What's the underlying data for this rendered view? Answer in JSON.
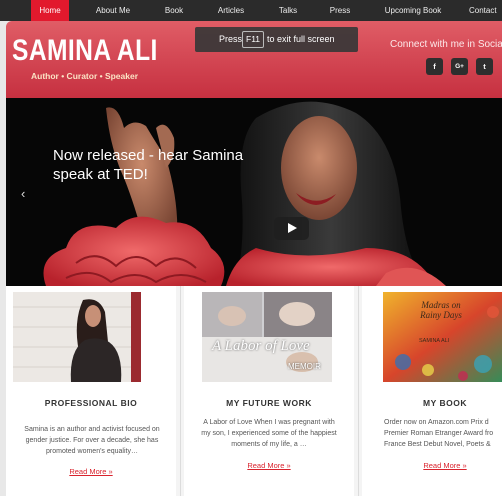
{
  "nav": {
    "items": [
      "Home",
      "About Me",
      "Book",
      "Articles",
      "Talks",
      "Press",
      "Upcoming Book",
      "Contact"
    ]
  },
  "header": {
    "logo": "SAMINA ALI",
    "tagline": "Author • Curator • Speaker",
    "connect": "Connect with me in Social",
    "social": [
      "f",
      "G+",
      "t"
    ]
  },
  "fullscreen_notice": {
    "prefix": "Press",
    "key": "F11",
    "suffix": "to exit full screen"
  },
  "hero": {
    "caption": "Now released - hear Samina speak at TED!"
  },
  "cards": [
    {
      "title": "PROFESSIONAL BIO",
      "text": "Samina is an author and activist focused on gender justice. For over a decade, she has promoted women's equality…",
      "link": "Read More »"
    },
    {
      "title": "MY FUTURE WORK",
      "image_text": "A Labor of Love",
      "image_subtext": "MEMOIR",
      "text": "A Labor of Love When I was pregnant with my son, I experienced some of the happiest moments of my life, a …",
      "link": "Read More »"
    },
    {
      "title": "MY BOOK",
      "book_title": "Madras on Rainy Days",
      "book_author": "SAMINA ALI",
      "text": "Order now on Amazon.com Prix d Premier Roman Etranger Award fro France Best Debut Novel, Poets &",
      "link": "Read More »"
    }
  ],
  "colors": {
    "nav_bg": "#2b2b2b",
    "accent": "#e2192d",
    "header_top": "#e05d66",
    "header_bottom": "#c63040",
    "link": "#d9232d"
  }
}
